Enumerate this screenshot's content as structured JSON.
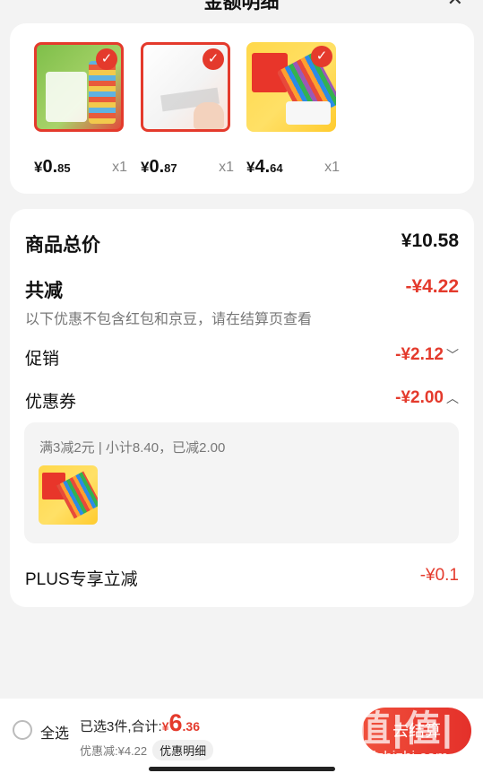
{
  "header": {
    "title": "金额明细",
    "close_icon": "close-icon"
  },
  "products": [
    {
      "price_yen": "¥",
      "price_int": "0.",
      "price_dec": "85",
      "qty": "x1",
      "selected": true
    },
    {
      "price_yen": "¥",
      "price_int": "0.",
      "price_dec": "87",
      "qty": "x1",
      "selected": true
    },
    {
      "price_yen": "¥",
      "price_int": "4.",
      "price_dec": "64",
      "qty": "x1",
      "selected": true
    }
  ],
  "summary": {
    "total_label": "商品总价",
    "total_value": "¥10.58",
    "reduce_label": "共减",
    "reduce_value": "-¥4.22",
    "reduce_note": "以下优惠不包含红包和京豆，请在结算页查看",
    "promo_label": "促销",
    "promo_value": "-¥2.12",
    "coupon_label": "优惠券",
    "coupon_value": "-¥2.00",
    "coupon_detail": "满3减2元 | 小计8.40，已减2.00",
    "plus_label": "PLUS专享立减",
    "plus_value": "-¥0.1"
  },
  "bottom_bar": {
    "select_all": "全选",
    "selected_count": "已选3件,合计:",
    "total_yen": "¥",
    "total_int": "6",
    "total_dec": ".36",
    "discount_text": "优惠减:¥4.22",
    "detail_button": "优惠明细",
    "checkout_button": "去结算"
  },
  "watermark": {
    "logo": "值|值|值",
    "site": "zhizhizhi.com"
  },
  "colors": {
    "accent": "#e43a2c",
    "background": "#f3f3f3",
    "card": "#ffffff"
  }
}
